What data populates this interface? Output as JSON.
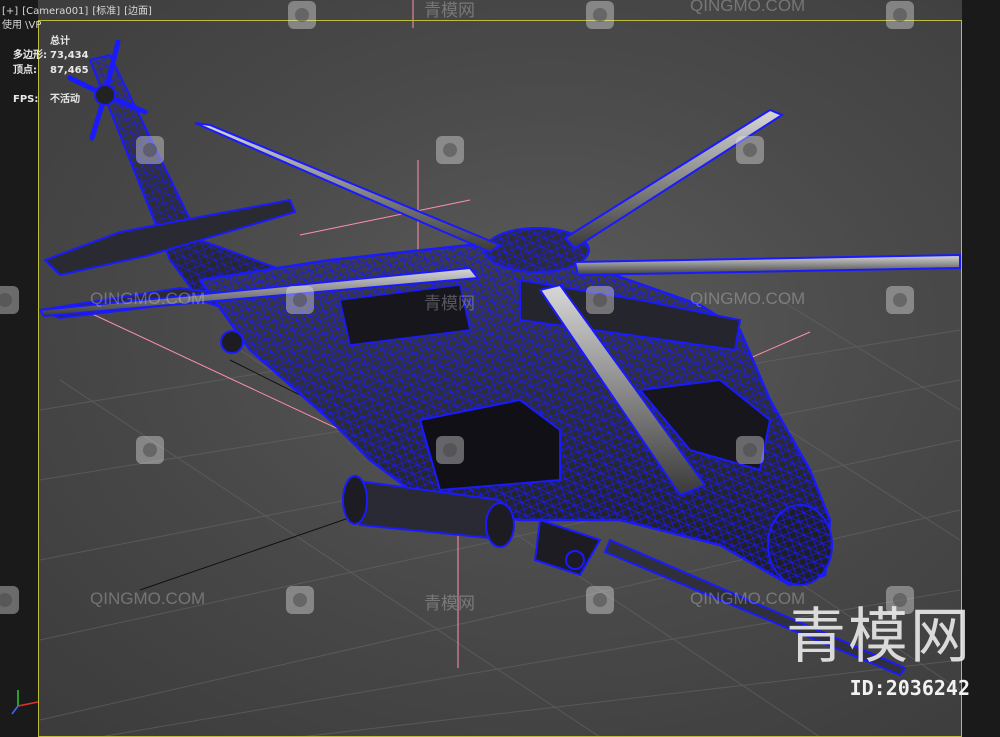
{
  "viewport": {
    "label_parts": [
      "[+]",
      "[Camera001]",
      "[标准]",
      "[边面]"
    ],
    "sub_label": "使用 \\VP",
    "stats": {
      "title": "总计",
      "polys_label": "多边形:",
      "polys_value": "73,434",
      "verts_label": "顶点:",
      "verts_value": "87,465",
      "fps_label": "FPS:",
      "fps_value": "不活动"
    }
  },
  "watermark": {
    "site_en": "QINGMO.COM",
    "site_cn": "青模网",
    "brand": "青模网",
    "id": "ID:2036242"
  },
  "colors": {
    "wire": "#1a1aff",
    "background": "#4a4a4a",
    "grid": "#6a6a6a",
    "axis_pink": "#ff8fb0",
    "frame": "#bdbd3a"
  },
  "model": {
    "subject": "helicopter-wireframe",
    "shading": "edged-faces"
  }
}
